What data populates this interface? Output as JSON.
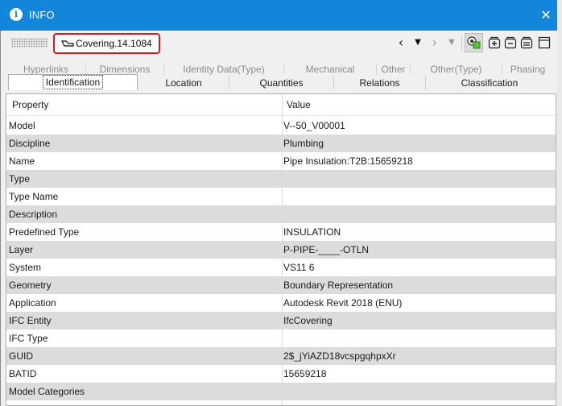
{
  "window": {
    "title": "INFO",
    "close_glyph": "✕",
    "info_glyph": "i"
  },
  "toolbar": {
    "selected_object": "Covering.14.1084",
    "selected_icon": "covering-shape-icon",
    "nav": {
      "previous": "‹",
      "previous_dropdown": "▼",
      "next": "›",
      "next_dropdown": "▼"
    },
    "icons": [
      "show-in-view-icon",
      "add-set-icon",
      "remove-set-icon",
      "edit-set-icon",
      "window-layout-icon"
    ]
  },
  "tabs": {
    "row1": [
      "Hyperlinks",
      "Dimensions",
      "Identity Data(Type)",
      "Mechanical",
      "Other",
      "Other(Type)",
      "Phasing"
    ],
    "row2": [
      "Identification",
      "Location",
      "Quantities",
      "Relations",
      "Classification"
    ],
    "active": "Identification"
  },
  "table": {
    "headers": {
      "property": "Property",
      "value": "Value"
    },
    "rows": [
      {
        "property": "Model",
        "value": "V--50_V00001"
      },
      {
        "property": "Discipline",
        "value": "Plumbing"
      },
      {
        "property": "Name",
        "value": "Pipe Insulation:T2B:15659218"
      },
      {
        "property": "Type",
        "value": ""
      },
      {
        "property": "Type Name",
        "value": ""
      },
      {
        "property": "Description",
        "value": ""
      },
      {
        "property": "Predefined Type",
        "value": "INSULATION"
      },
      {
        "property": "Layer",
        "value": "P-PIPE-____-OTLN"
      },
      {
        "property": "System",
        "value": "VS11 6"
      },
      {
        "property": "Geometry",
        "value": "Boundary Representation"
      },
      {
        "property": "Application",
        "value": "Autodesk Revit 2018 (ENU)"
      },
      {
        "property": "IFC Entity",
        "value": "IfcCovering"
      },
      {
        "property": "IFC Type",
        "value": ""
      },
      {
        "property": "GUID",
        "value": "2$_jYiAZD18vcspgqhpxXr"
      },
      {
        "property": "BATID",
        "value": "15659218"
      },
      {
        "property": "Model Categories",
        "value": ""
      }
    ]
  },
  "colors": {
    "titlebar": "#1486d9",
    "highlight_border": "#d11b1b",
    "alt_row": "#dcdcdc",
    "inactive_tab_text": "#8a8a8a"
  }
}
